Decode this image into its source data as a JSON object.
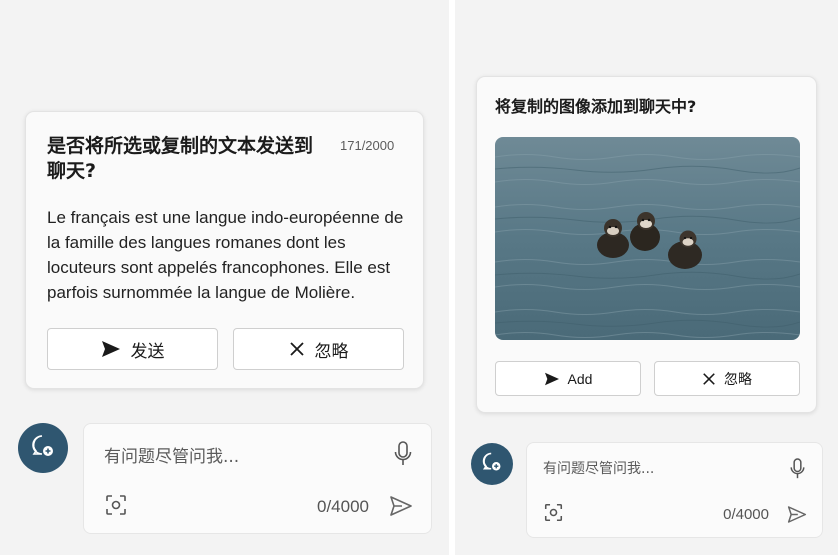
{
  "left_panel": {
    "card": {
      "title": "是否将所选或复制的文本发送到聊天?",
      "counter": "171/2000",
      "body": "Le français est une langue indo-européenne de la famille des langues romanes dont les locuteurs sont appelés francophones. Elle est parfois surnommée la langue de Molière.",
      "send_label": "发送",
      "ignore_label": "忽略"
    },
    "composer": {
      "placeholder": "有问题尽管问我...",
      "count": "0/4000"
    }
  },
  "right_panel": {
    "card": {
      "title": "将复制的图像添加到聊天中?",
      "add_label": "Add",
      "ignore_label": "忽略"
    },
    "composer": {
      "placeholder": "有问题尽管问我...",
      "count": "0/4000"
    }
  },
  "icons": {
    "send": "paper-plane-icon",
    "ignore": "close-icon",
    "mic": "microphone-icon",
    "camera": "screenshot-capture-icon",
    "avatar": "new-chat-icon"
  },
  "colors": {
    "avatar": "#2f5670",
    "background": "#f3f3f3",
    "card": "#fafafa"
  }
}
